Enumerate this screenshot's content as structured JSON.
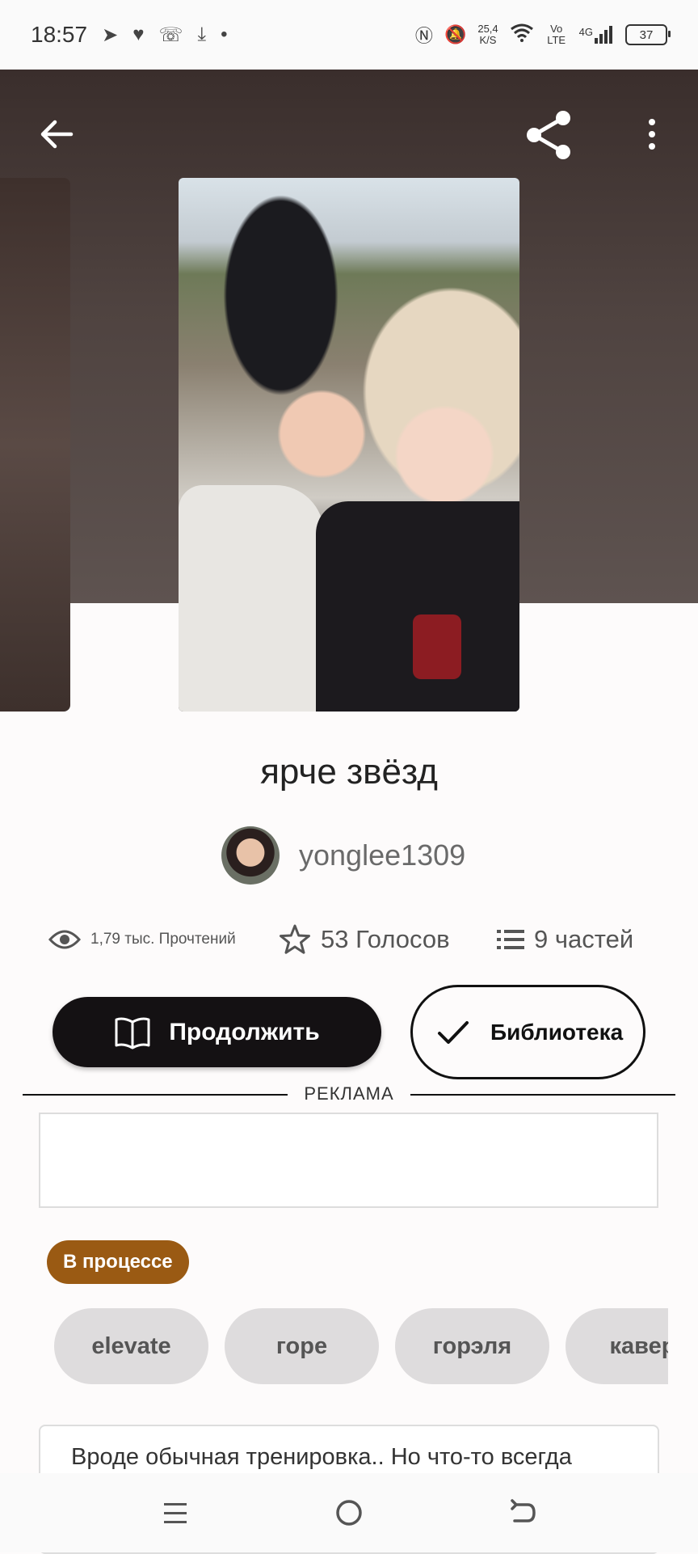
{
  "status_bar": {
    "time": "18:57",
    "net_speed_value": "25,4",
    "net_speed_unit": "K/S",
    "volte": "Vo LTE",
    "network": "4G",
    "battery": "37"
  },
  "story": {
    "title": "ярче звёзд",
    "author": "yonglee1309",
    "reads": "1,79 тыс. Прочтений",
    "votes": "53 Голосов",
    "parts": "9 частей"
  },
  "actions": {
    "continue_label": "Продолжить",
    "library_label": "Библиотека"
  },
  "ad": {
    "label": "РЕКЛАМА"
  },
  "status_badge": "В процессе",
  "tags": [
    "elevate",
    "горе",
    "горэля",
    "кавер"
  ],
  "description": "Вроде обычная тренировка.. Но что-то всегда"
}
